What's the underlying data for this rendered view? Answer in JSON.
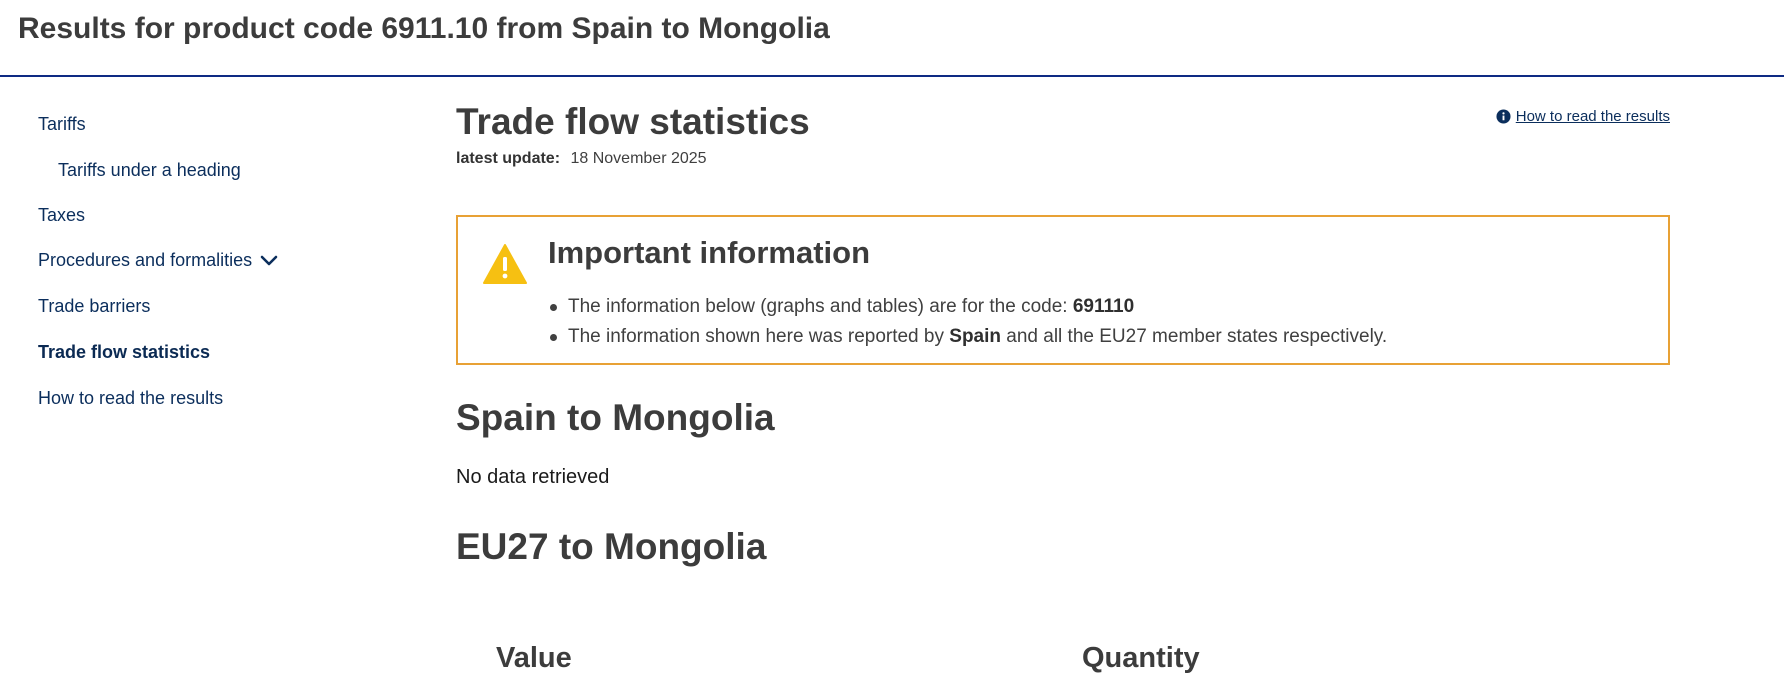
{
  "header": {
    "title": "Results for product code 6911.10 from Spain to Mongolia"
  },
  "sidebar": {
    "items": [
      {
        "label": "Tariffs"
      },
      {
        "label": "Tariffs under a heading"
      },
      {
        "label": "Taxes"
      },
      {
        "label": "Procedures and formalities"
      },
      {
        "label": "Trade barriers"
      },
      {
        "label": "Trade flow statistics"
      },
      {
        "label": "How to read the results"
      }
    ],
    "active": "Trade flow statistics"
  },
  "main": {
    "title": "Trade flow statistics",
    "update_label": "latest update:",
    "update_date": "18 November 2025",
    "help_link": "How to read the results",
    "important": {
      "title": "Important information",
      "line1_text": "The information below (graphs and tables) are for the code:",
      "line1_code": "691110",
      "line2_pre": "The information shown here was reported by",
      "line2_bold": "Spain",
      "line2_post": "and all the EU27 member states respectively."
    },
    "section1": {
      "title": "Spain to Mongolia",
      "message": "No data retrieved"
    },
    "section2": {
      "title": "EU27 to Mongolia",
      "col_value": "Value",
      "col_quantity": "Quantity"
    }
  },
  "colors": {
    "accent": "#0e2a83",
    "warning_border": "#e8a135",
    "warning_icon": "#f6c012",
    "link": "#0b2e5c"
  },
  "icons": {
    "warning": "warning-triangle-icon",
    "info": "info-circle-icon",
    "chevron": "chevron-down-icon"
  }
}
